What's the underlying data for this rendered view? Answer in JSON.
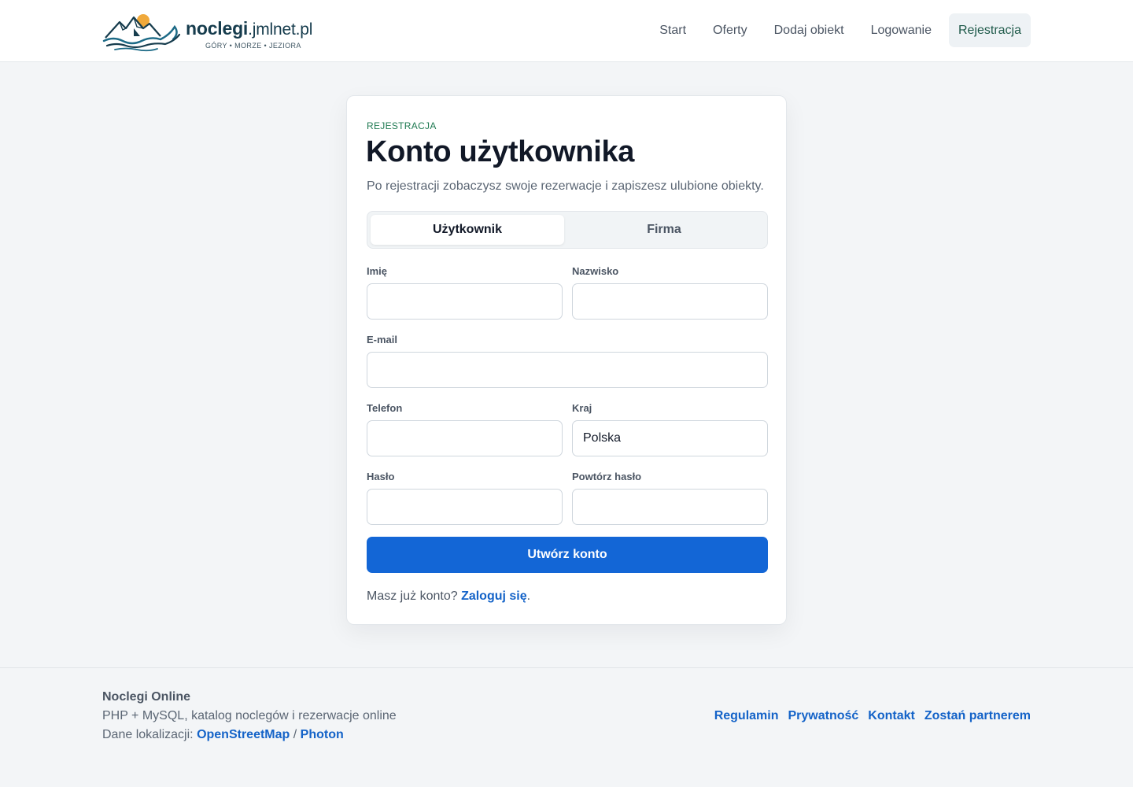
{
  "header": {
    "logo": {
      "name_bold": "noclegi",
      "name_light": ".jmlnet.pl",
      "tagline": "GÓRY • MORZE • JEZIORA",
      "icon": "mountain-sea-logo-icon",
      "colors": {
        "dark": "#163c4d",
        "sun": "#f0a93b"
      }
    },
    "nav": [
      {
        "label": "Start"
      },
      {
        "label": "Oferty"
      },
      {
        "label": "Dodaj obiekt"
      },
      {
        "label": "Logowanie"
      },
      {
        "label": "Rejestracja",
        "active": true
      }
    ]
  },
  "card": {
    "eyebrow": "REJESTRACJA",
    "title": "Konto użytkownika",
    "subtitle": "Po rejestracji zobaczysz swoje rezerwacje i zapiszesz ulubione obiekty.",
    "tabs": [
      {
        "label": "Użytkownik",
        "selected": true
      },
      {
        "label": "Firma",
        "selected": false
      }
    ],
    "fields": {
      "first_name": {
        "label": "Imię",
        "value": ""
      },
      "last_name": {
        "label": "Nazwisko",
        "value": ""
      },
      "email": {
        "label": "E-mail",
        "value": ""
      },
      "phone": {
        "label": "Telefon",
        "value": ""
      },
      "country": {
        "label": "Kraj",
        "value": "Polska"
      },
      "password": {
        "label": "Hasło",
        "value": ""
      },
      "password_repeat": {
        "label": "Powtórz hasło",
        "value": ""
      }
    },
    "submit_label": "Utwórz konto",
    "login_prompt": "Masz już konto?",
    "login_link": "Zaloguj się",
    "login_suffix": "."
  },
  "footer": {
    "brand": "Noclegi Online",
    "description": "PHP + MySQL, katalog noclegów i rezerwacje online",
    "data_prefix": "Dane lokalizacji:",
    "data_links": [
      "OpenStreetMap",
      "Photon"
    ],
    "data_separator": "/",
    "links": [
      "Regulamin",
      "Prywatność",
      "Kontakt",
      "Zostań partnerem"
    ]
  },
  "colors": {
    "accent": "#1366d6",
    "link": "#1463c8",
    "eyebrow": "#1f7a52",
    "page_bg": "#f3f5f7"
  }
}
